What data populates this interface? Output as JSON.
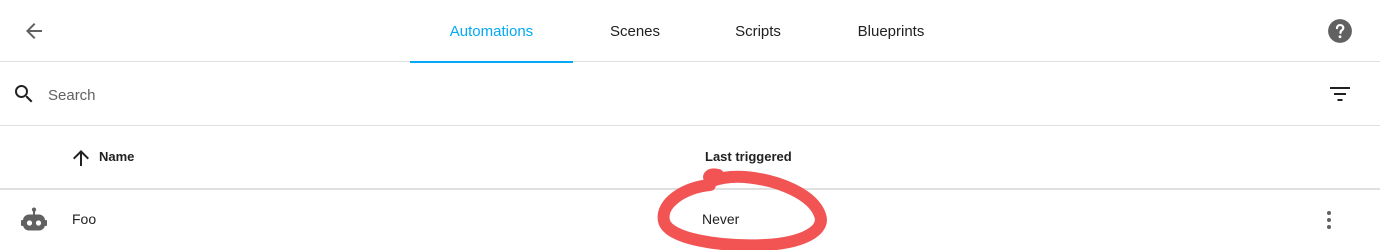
{
  "header": {
    "tabs": [
      {
        "label": "Automations",
        "active": true
      },
      {
        "label": "Scenes",
        "active": false
      },
      {
        "label": "Scripts",
        "active": false
      },
      {
        "label": "Blueprints",
        "active": false
      }
    ],
    "icons": {
      "back": "arrow-left-icon",
      "help": "help-circle-icon"
    }
  },
  "search": {
    "placeholder": "Search",
    "value": "",
    "icons": {
      "search": "magnify-icon",
      "filter": "filter-variant-icon"
    }
  },
  "table": {
    "columns": [
      {
        "label": "Name",
        "sort": "ascending"
      },
      {
        "label": "Last triggered"
      }
    ],
    "rows": [
      {
        "icon": "robot-icon",
        "name": "Foo",
        "last_triggered": "Never"
      }
    ]
  },
  "colors": {
    "accent": "#03a9f4",
    "icon": "#616161",
    "annotation": "#f25454"
  }
}
